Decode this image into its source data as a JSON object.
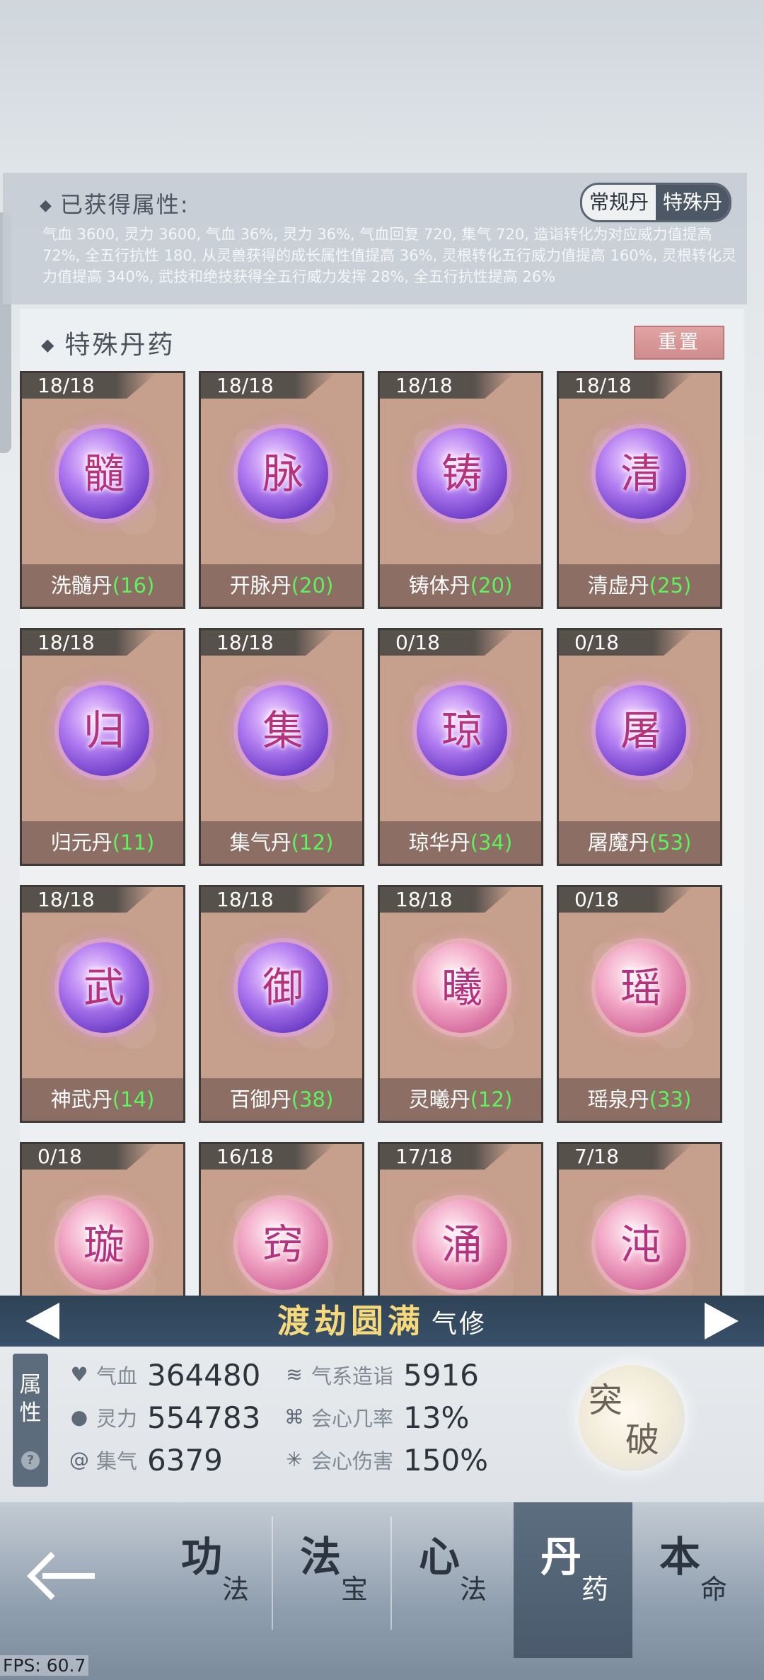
{
  "attributes": {
    "title": "已获得属性:",
    "toggle": [
      "常规丹",
      "特殊丹"
    ],
    "text": "气血 3600, 灵力 3600, 气血 36%, 灵力 36%, 气血回复 720, 集气 720, 造诣转化为对应威力值提高 72%, 全五行抗性 180, 从灵兽获得的成长属性值提高 36%, 灵根转化五行威力值提高 160%, 灵根转化灵力值提高 340%, 武技和绝技获得全五行威力发挥 28%, 全五行抗性提高 26%"
  },
  "pills": {
    "title": "特殊丹药",
    "reset_label": "重置",
    "items": [
      {
        "count": "18/18",
        "glyph": "髓",
        "name": "洗髓丹",
        "level": "(16)",
        "color": "purple"
      },
      {
        "count": "18/18",
        "glyph": "脉",
        "name": "开脉丹",
        "level": "(20)",
        "color": "purple"
      },
      {
        "count": "18/18",
        "glyph": "铸",
        "name": "铸体丹",
        "level": "(20)",
        "color": "purple"
      },
      {
        "count": "18/18",
        "glyph": "清",
        "name": "清虚丹",
        "level": "(25)",
        "color": "purple"
      },
      {
        "count": "18/18",
        "glyph": "归",
        "name": "归元丹",
        "level": "(11)",
        "color": "purple"
      },
      {
        "count": "18/18",
        "glyph": "集",
        "name": "集气丹",
        "level": "(12)",
        "color": "purple"
      },
      {
        "count": "0/18",
        "glyph": "琼",
        "name": "琼华丹",
        "level": "(34)",
        "color": "purple"
      },
      {
        "count": "0/18",
        "glyph": "屠",
        "name": "屠魔丹",
        "level": "(53)",
        "color": "purple"
      },
      {
        "count": "18/18",
        "glyph": "武",
        "name": "神武丹",
        "level": "(14)",
        "color": "purple"
      },
      {
        "count": "18/18",
        "glyph": "御",
        "name": "百御丹",
        "level": "(38)",
        "color": "purple"
      },
      {
        "count": "18/18",
        "glyph": "曦",
        "name": "灵曦丹",
        "level": "(12)",
        "color": "pink"
      },
      {
        "count": "0/18",
        "glyph": "瑶",
        "name": "瑶泉丹",
        "level": "(33)",
        "color": "pink"
      },
      {
        "count": "0/18",
        "glyph": "璇",
        "name": "",
        "level": "",
        "color": "pink"
      },
      {
        "count": "16/18",
        "glyph": "窍",
        "name": "",
        "level": "",
        "color": "pink"
      },
      {
        "count": "17/18",
        "glyph": "涌",
        "name": "",
        "level": "",
        "color": "pink"
      },
      {
        "count": "7/18",
        "glyph": "沌",
        "name": "",
        "level": "",
        "color": "pink"
      }
    ]
  },
  "realm": {
    "name": "渡劫圆满",
    "type": "气修"
  },
  "stats": {
    "label": "属性",
    "help": "?",
    "items": [
      {
        "icon": "heart-icon",
        "label": "气血",
        "value": "364480"
      },
      {
        "icon": "drop-icon",
        "label": "灵力",
        "value": "554783"
      },
      {
        "icon": "swirl-icon",
        "label": "集气",
        "value": "6379"
      },
      {
        "icon": "wind-icon",
        "label": "气系造诣",
        "value": "5916"
      },
      {
        "icon": "crit-rate-icon",
        "label": "会心几率",
        "value": "13%"
      },
      {
        "icon": "crit-damage-icon",
        "label": "会心伤害",
        "value": "150%"
      }
    ],
    "breakthrough": [
      "突",
      "破"
    ]
  },
  "nav": {
    "tabs": [
      {
        "big": "功",
        "small": "法"
      },
      {
        "big": "法",
        "small": "宝"
      },
      {
        "big": "心",
        "small": "法"
      },
      {
        "big": "丹",
        "small": "药"
      },
      {
        "big": "本",
        "small": "命"
      }
    ],
    "active_index": 3
  },
  "fps": "FPS: 60.7"
}
